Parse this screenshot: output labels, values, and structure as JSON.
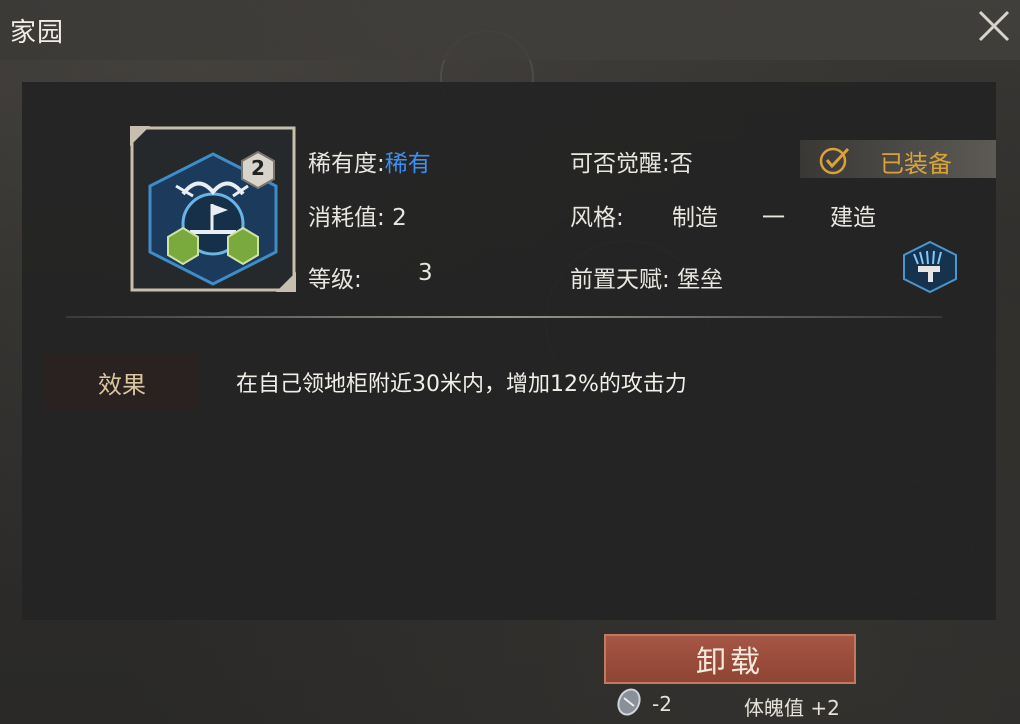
{
  "window": {
    "title": "家园",
    "close_icon": "close-icon"
  },
  "item": {
    "level_badge": "2",
    "icon": "winged-flag-emblem-icon"
  },
  "attributes": {
    "rarity_label": "稀有度:",
    "rarity_value": "稀有",
    "cost_label": "消耗值:",
    "cost_value": "2",
    "level_label": "等级:",
    "level_value": "3",
    "awaken_label": "可否觉醒:",
    "awaken_value": "否",
    "style_label": "风格:",
    "style_value_1": "制造",
    "style_dash": "一",
    "style_value_2": "建造",
    "prereq_label": "前置天赋:",
    "prereq_value": "堡垒"
  },
  "status": {
    "equipped_label": "已装备",
    "icon": "check-circle-icon"
  },
  "effect": {
    "tag": "效果",
    "text": "在自己领地柜附近30米内，增加12%的攻击力"
  },
  "actions": {
    "unload_label": "卸载"
  },
  "footer": {
    "cost_change": "-2",
    "stat_change": "体魄值 +2"
  },
  "colors": {
    "rarity_blue": "#3f8ff0",
    "equipped_gold": "#d9a23a",
    "button_red": "#a65645"
  }
}
